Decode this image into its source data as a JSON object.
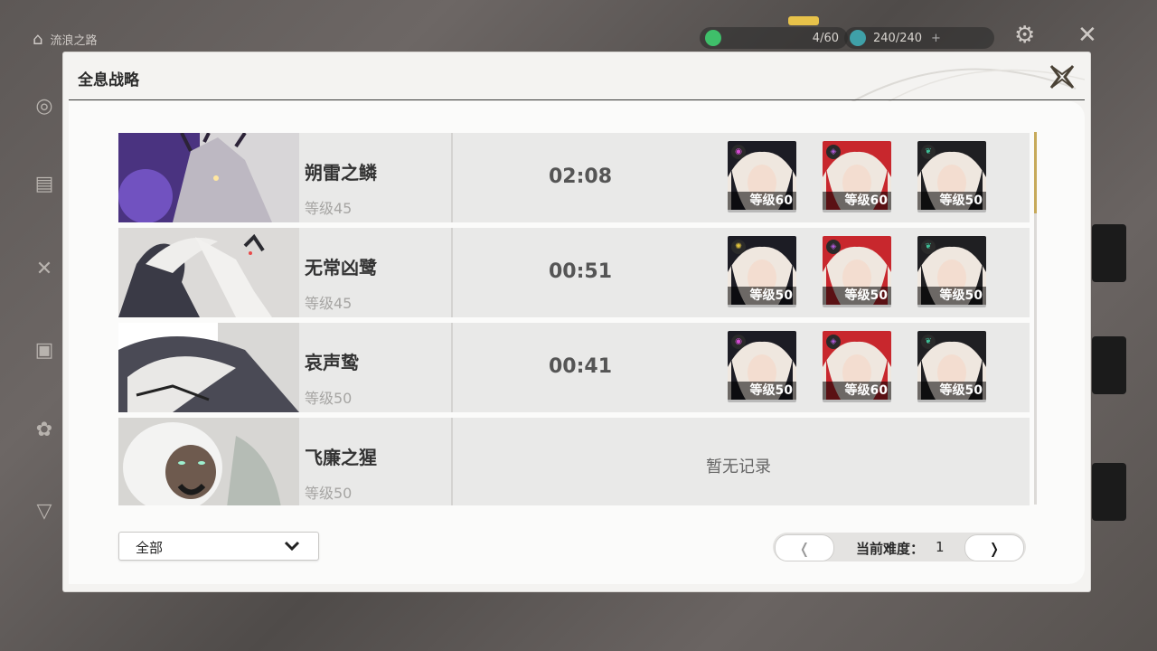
{
  "hud": {
    "top_left_label": "流浪之路",
    "resource_1": {
      "value": "4/60",
      "color": "#3fbf6a"
    },
    "resource_2": {
      "value": "240/240",
      "color": "#3fa0a8"
    }
  },
  "panel": {
    "title": "全息战略",
    "close_icon": "close-x-icon"
  },
  "bosses": [
    {
      "name": "朔雷之鳞",
      "level": "等级45",
      "time": "02:08",
      "theme": "#6b4fb0",
      "team": [
        {
          "level": "等级60",
          "element": "electro-icon",
          "element_color": "#d64bd4",
          "hair": "#1c1c24"
        },
        {
          "level": "等级60",
          "element": "havoc-icon",
          "element_color": "#b05ad8",
          "hair": "#c8272d"
        },
        {
          "level": "等级50",
          "element": "aero-icon",
          "element_color": "#3fc29a",
          "hair": "#1f1f22"
        }
      ]
    },
    {
      "name": "无常凶鹭",
      "level": "等级45",
      "time": "00:51",
      "theme": "#3a3a46",
      "team": [
        {
          "level": "等级50",
          "element": "spectro-icon",
          "element_color": "#e0c23c",
          "hair": "#1c1c24"
        },
        {
          "level": "等级50",
          "element": "havoc-icon",
          "element_color": "#b05ad8",
          "hair": "#c8272d"
        },
        {
          "level": "等级50",
          "element": "aero-icon",
          "element_color": "#3fc29a",
          "hair": "#1f1f22"
        }
      ]
    },
    {
      "name": "哀声鸷",
      "level": "等级50",
      "time": "00:41",
      "theme": "#4a4a55",
      "team": [
        {
          "level": "等级50",
          "element": "electro-icon",
          "element_color": "#d64bd4",
          "hair": "#1c1c24"
        },
        {
          "level": "等级60",
          "element": "havoc-icon",
          "element_color": "#b05ad8",
          "hair": "#c8272d"
        },
        {
          "level": "等级50",
          "element": "aero-icon",
          "element_color": "#3fc29a",
          "hair": "#1f1f22"
        }
      ]
    },
    {
      "name": "飞廉之猩",
      "level": "等级50",
      "no_record": "暂无记录",
      "theme": "#7a7a7a"
    }
  ],
  "filter": {
    "label": "全部"
  },
  "pagination": {
    "label": "当前难度：",
    "value": "1"
  }
}
